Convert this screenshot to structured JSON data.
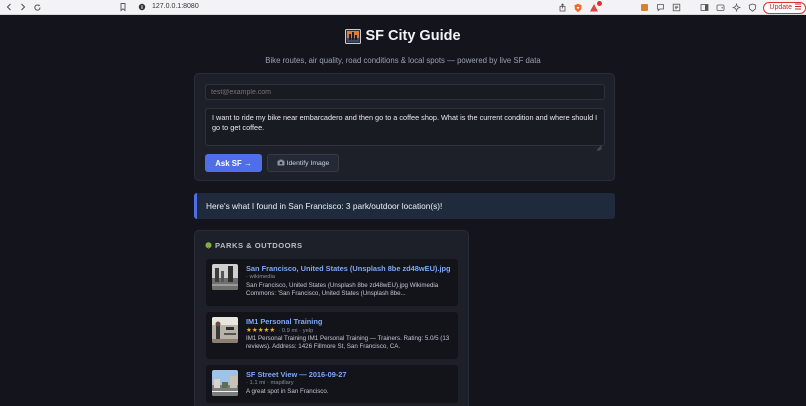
{
  "browser": {
    "url": "127.0.0.1:8080",
    "update_label": "Update"
  },
  "header": {
    "title": "SF City Guide",
    "subtitle": "Bike routes, air quality, road conditions & local spots — powered by live SF data"
  },
  "form": {
    "email_placeholder": "test@example.com",
    "question_value": "I want to ride my bike near embarcadero and then go to a coffee shop. What is the current condition and where should I go to get coffee.",
    "ask_label": "Ask SF →",
    "identify_label": "Identify Image"
  },
  "result": {
    "banner": "Here's what I found in San Francisco: 3 park/outdoor location(s)!"
  },
  "parks": {
    "heading": "PARKS & OUTDOORS",
    "items": [
      {
        "title": "San Francisco, United States (Unsplash 8be zd48wEU).jpg",
        "meta": "· wikimedia",
        "desc": "San Francisco, United States (Unsplash 8be zd48wEU).jpg Wikimedia Commons: 'San Francisco, United States (Unsplash 8be..."
      },
      {
        "title": "IM1 Personal Training",
        "stars": "★★★★★",
        "meta": "· 0.9 mi · yelp",
        "rating": 5,
        "desc": "IM1 Personal Training IM1 Personal Training — Trainers. Rating: 5.0/5 (13 reviews). Address: 1426 Fillmore St, San Francisco, CA."
      },
      {
        "title": "SF Street View — 2016-09-27",
        "meta": "· 1.1 mi · mapillary",
        "desc": "A great spot in San Francisco."
      }
    ]
  },
  "colors": {
    "accent": "#4e6fe8",
    "link": "#7fa8f5",
    "star": "#f2b21c",
    "background": "#14151c",
    "card": "#1e2029"
  }
}
